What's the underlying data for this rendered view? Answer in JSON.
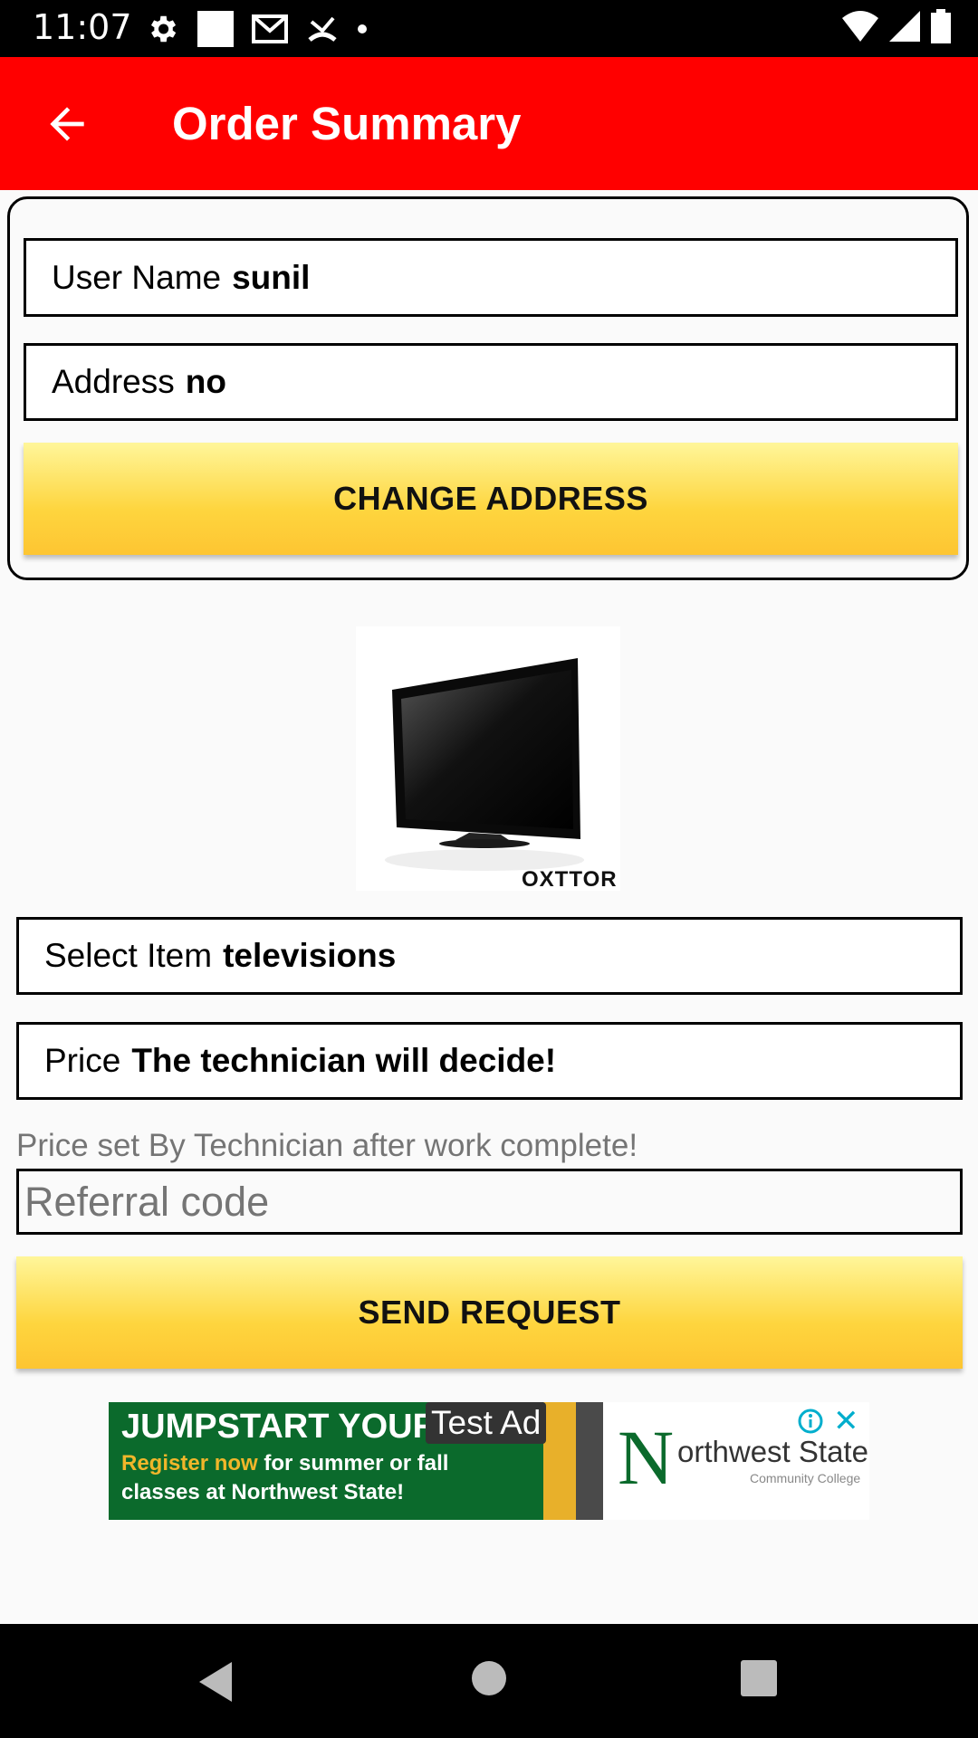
{
  "status_bar": {
    "time": "11:07"
  },
  "app_bar": {
    "title": "Order Summary"
  },
  "user_card": {
    "user_name_label": "User Name",
    "user_name_value": "sunil",
    "address_label": "Address",
    "address_value": "no",
    "change_address_label": "CHANGE ADDRESS"
  },
  "product": {
    "brand": "OXTTOR"
  },
  "item": {
    "label": "Select Item",
    "value": "televisions"
  },
  "price": {
    "label": "Price",
    "value": "The technician will decide!"
  },
  "price_hint": "Price set By Technician after work complete!",
  "referral": {
    "placeholder": "Referral code"
  },
  "send_request_label": "SEND REQUEST",
  "ad": {
    "headline": "JUMPSTART YOUR F",
    "badge": "Test Ad",
    "line2_highlight": "Register now",
    "line2_rest": " for summer or fall",
    "line3": "classes at Northwest State!",
    "logo_text": "orthwest State",
    "logo_sub": "Community College",
    "close": "✕"
  },
  "colors": {
    "app_bar": "#ff0000",
    "button_top": "#fff69a",
    "button_bottom": "#fdc532"
  },
  "icons": [
    "back-arrow-icon",
    "settings-icon",
    "gmail-icon",
    "info-icon",
    "close-icon",
    "wifi-icon",
    "signal-icon",
    "battery-icon"
  ]
}
